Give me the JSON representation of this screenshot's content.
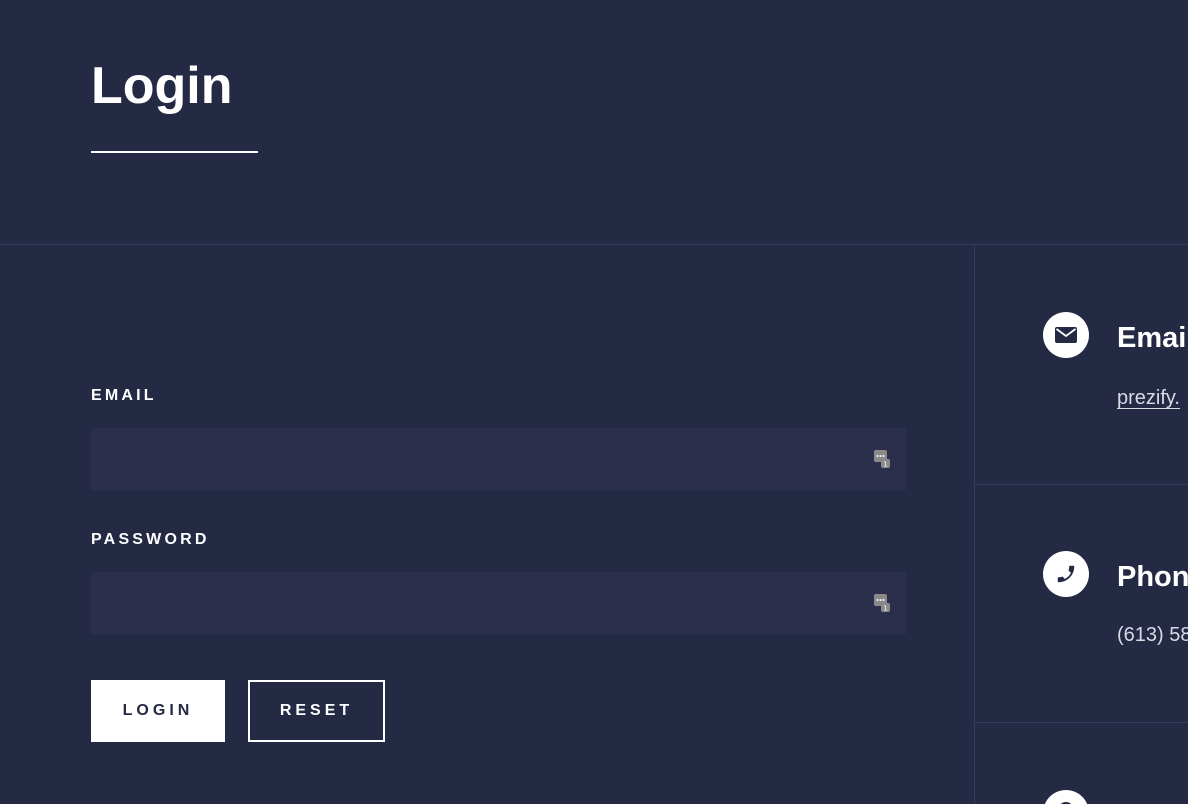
{
  "page": {
    "title": "Login"
  },
  "form": {
    "email_label": "EMAIL",
    "email_value": "",
    "password_label": "PASSWORD",
    "password_value": "",
    "login_label": "LOGIN",
    "reset_label": "RESET"
  },
  "contact": {
    "email_title": "Email",
    "email_value": "prezify.",
    "phone_title": "Phone",
    "phone_value": "(613) 58"
  },
  "icons": {
    "email": "envelope-icon",
    "phone": "phone-icon",
    "third": "map-marker-icon",
    "password_manager": "password-manager-icon"
  },
  "colors": {
    "background": "#242944",
    "input_background": "#2b2f4b",
    "divider": "#353a58",
    "text": "#ffffff"
  }
}
